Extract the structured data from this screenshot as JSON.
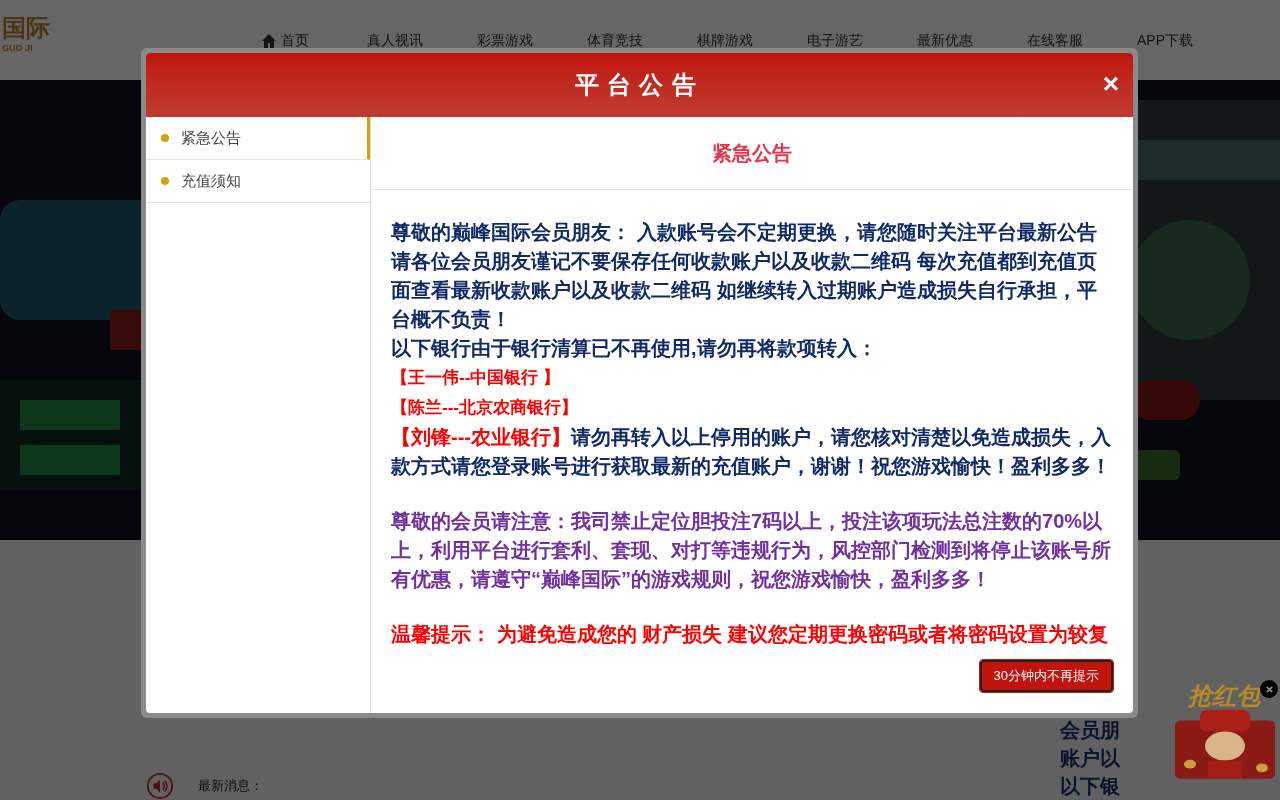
{
  "header": {
    "logo_text": "国际",
    "logo_subtext": "GUO JI",
    "nav": [
      {
        "label": "首页"
      },
      {
        "label": "真人视讯"
      },
      {
        "label": "彩票游戏"
      },
      {
        "label": "体育竞技"
      },
      {
        "label": "棋牌游戏"
      },
      {
        "label": "电子游艺"
      },
      {
        "label": "最新优惠"
      },
      {
        "label": "在线客服"
      },
      {
        "label": "APP下载"
      }
    ]
  },
  "background_notice": {
    "lines": [
      "会员朋",
      "账户以",
      "以下银"
    ]
  },
  "news_bar": {
    "label": "最新消息："
  },
  "red_packet": {
    "label": "抢红包"
  },
  "modal": {
    "title": "平台公告",
    "close": "×",
    "tabs": [
      {
        "label": "紧急公告",
        "selected": true
      },
      {
        "label": "充值须知",
        "selected": false
      }
    ],
    "content_title": "紧急公告",
    "paragraphs": [
      {
        "kind": "text",
        "runs": [
          {
            "text": "尊敬的巅峰国际会员朋友： 入款账号会不定期更换，请您随时关注平台最新公告",
            "color": "#102a66"
          }
        ]
      },
      {
        "kind": "text",
        "runs": [
          {
            "text": "请各位会员朋友谨记不要保存任何收款账户以及收款二维码 每次充值都到充值页面查看最新收款账户以及收款二维码 如继续转入过期账户造成损失自行承担，平台概不负责！",
            "color": "#102a66"
          }
        ]
      },
      {
        "kind": "text",
        "runs": [
          {
            "text": "以下银行由于银行清算已不再使用,请勿再将款项转入：",
            "color": "#102a66"
          }
        ]
      },
      {
        "kind": "small",
        "runs": [
          {
            "text": "【王一伟--中国银行 】",
            "color": "#ff0000"
          }
        ]
      },
      {
        "kind": "small",
        "runs": [
          {
            "text": "【陈兰---北京农商银行】",
            "color": "#ff0000"
          }
        ]
      },
      {
        "kind": "text",
        "runs": [
          {
            "text": "【刘锋---农业银行】",
            "color": "#ff0000"
          },
          {
            "text": "请勿再转入以上停用的账户，请您核对清楚以免造成损失，入款方式请您登录账号进行获取最新的充值账户，谢谢！祝您游戏愉快！盈利多多！",
            "color": "#102a66"
          }
        ]
      },
      {
        "kind": "gap"
      },
      {
        "kind": "text",
        "runs": [
          {
            "text": "尊敬的会员请注意：我司禁止定位胆投注7码以上，投注该项玩法总注数的70%以上，利用平台进行套利、套现、对打等违规行为，风控部门检测到将停止该账号所有优惠，请遵守“巅峰国际”的游戏规则，祝您游戏愉快，盈利多多！",
            "color": "#7030a0"
          }
        ]
      },
      {
        "kind": "gap"
      },
      {
        "kind": "text",
        "runs": [
          {
            "text": "温馨提示： 为避免造成您的 财产损失 建议您定期更换密码或者将密码设置为较复",
            "color": "#ff0000"
          }
        ]
      }
    ],
    "dismiss_button": "30分钟内不再提示"
  }
}
